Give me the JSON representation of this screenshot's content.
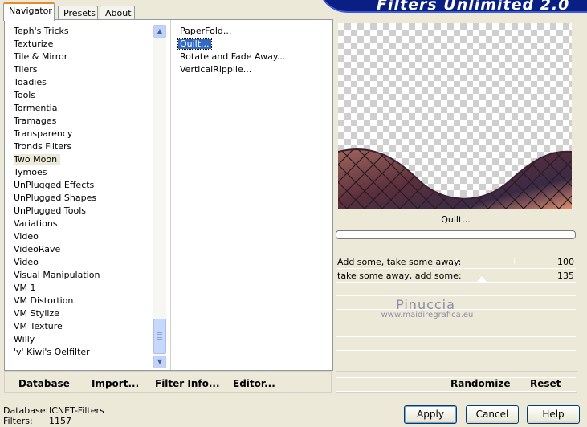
{
  "tabs": [
    {
      "label": "Navigator",
      "active": true
    },
    {
      "label": "Presets",
      "active": false
    },
    {
      "label": "About",
      "active": false
    }
  ],
  "banner_title": "Filters Unlimited 2.0",
  "categories": [
    "Teph's Tricks",
    "Texturize",
    "Tile & Mirror",
    "Tilers",
    "Toadies",
    "Tools",
    "Tormentia",
    "Tramages",
    "Transparency",
    "Tronds Filters",
    "Two Moon",
    "Tymoes",
    "UnPlugged Effects",
    "UnPlugged Shapes",
    "UnPlugged Tools",
    "Variations",
    "Video",
    "VideoRave",
    "Video",
    "Visual Manipulation",
    "VM 1",
    "VM Distortion",
    "VM Stylize",
    "VM Texture",
    "Willy",
    "'v' Kiwi's Oelfilter"
  ],
  "selected_category": "Two Moon",
  "filters": [
    "PaperFold...",
    "Quilt...",
    "Rotate and Fade Away...",
    "VerticalRipplie..."
  ],
  "selected_filter": "Quilt...",
  "left_buttons": {
    "database": "Database",
    "import": "Import...",
    "filter_info": "Filter Info...",
    "editor": "Editor..."
  },
  "current_filter_label": "Quilt...",
  "params": [
    {
      "label": "Add some, take some away:",
      "value": "100",
      "level": 100
    },
    {
      "label": "take some away, add some:",
      "value": "135",
      "level": 135
    }
  ],
  "watermark": {
    "line1": "Pinuccia",
    "line2": "www.maidiregrafica.eu"
  },
  "right_buttons": {
    "randomize": "Randomize",
    "reset": "Reset"
  },
  "status": {
    "database_label": "Database:",
    "database_value": "ICNET-Filters",
    "filters_label": "Filters:",
    "filters_value": "1157"
  },
  "dialog_buttons": {
    "apply": "Apply",
    "cancel": "Cancel",
    "help": "Help"
  },
  "colors": {
    "banner": "#0a1f84",
    "selection": "#316ac5",
    "tab_highlight": "#e68b2c"
  }
}
